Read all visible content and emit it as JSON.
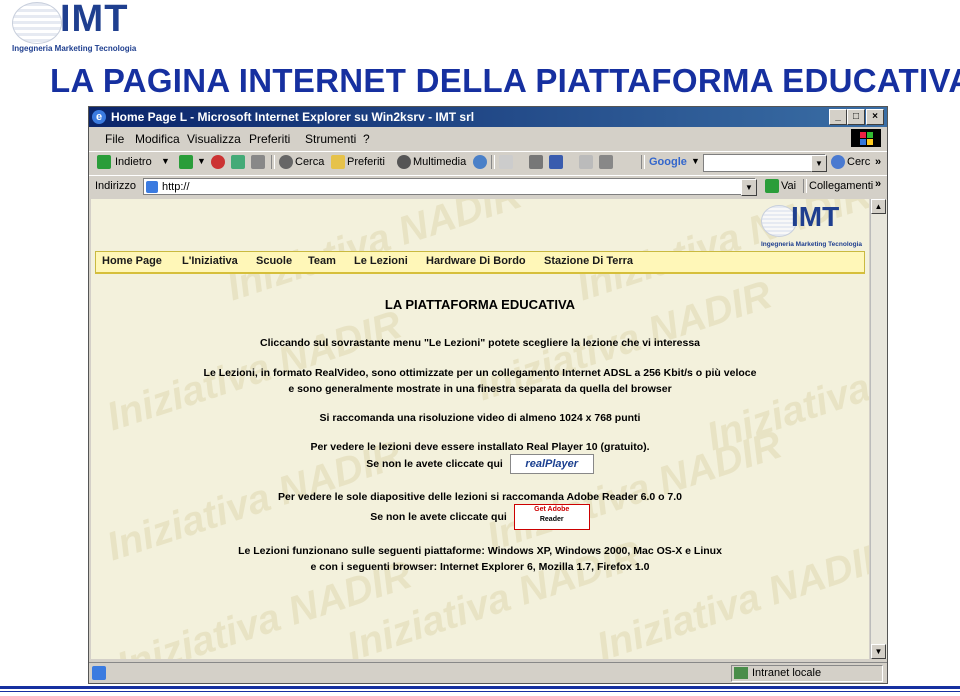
{
  "slide": {
    "logo_text": "IMT",
    "logo_subtitle": "Ingegneria Marketing Tecnologia",
    "title": "LA PAGINA INTERNET DELLA PIATTAFORMA EDUCATIVA"
  },
  "browser": {
    "window_title": "Home Page L - Microsoft Internet Explorer su Win2ksrv - IMT srl",
    "menu": [
      "File",
      "Modifica",
      "Visualizza",
      "Preferiti",
      "Strumenti",
      "?"
    ],
    "toolbar": {
      "back": "Indietro",
      "search": "Cerca",
      "favorites": "Preferiti",
      "multimedia": "Multimedia",
      "google": "Google",
      "cerc": "Cerc"
    },
    "address_label": "Indirizzo",
    "address_value": "http://",
    "go_label": "Vai",
    "links_label": "Collegamenti",
    "status_zone": "Intranet locale"
  },
  "page": {
    "logo_text": "IMT",
    "logo_subtitle": "Ingegneria Marketing Tecnologia",
    "watermark": "Iniziativa NADIR",
    "nav": [
      "Home Page",
      "L'Iniziativa",
      "Scuole",
      "Team",
      "Le Lezioni",
      "Hardware Di Bordo",
      "Stazione Di Terra"
    ],
    "heading": "LA PIATTAFORMA EDUCATIVA",
    "lines": {
      "menu_hint": "Cliccando sul sovrastante menu \"Le Lezioni\" potete scegliere la lezione che vi interessa",
      "format_1": "Le Lezioni, in formato RealVideo, sono ottimizzate per un collegamento Internet ADSL a 256 Kbit/s o più veloce",
      "format_2": "e sono generalmente mostrate in una finestra separata da quella del browser",
      "resolution": "Si raccomanda una risoluzione video di almeno 1024 x 768 punti",
      "realplayer_req": "Per vedere le lezioni deve essere installato Real Player 10 (gratuito).",
      "realplayer_click": "Se non le avete cliccate qui",
      "realplayer_button": "realPlayer",
      "adobe_req": "Per vedere le sole diapositive delle lezioni si raccomanda Adobe Reader 6.0 o 7.0",
      "adobe_click": "Se non le avete cliccate qui",
      "adobe_button_1": "Get Adobe",
      "adobe_button_2": "Reader",
      "platforms": "Le Lezioni funzionano sulle seguenti piattaforme: Windows XP, Windows 2000, Mac OS-X e Linux",
      "browsers": "e con i seguenti browser: Internet Explorer 6, Mozilla 1.7, Firefox 1.0"
    }
  }
}
